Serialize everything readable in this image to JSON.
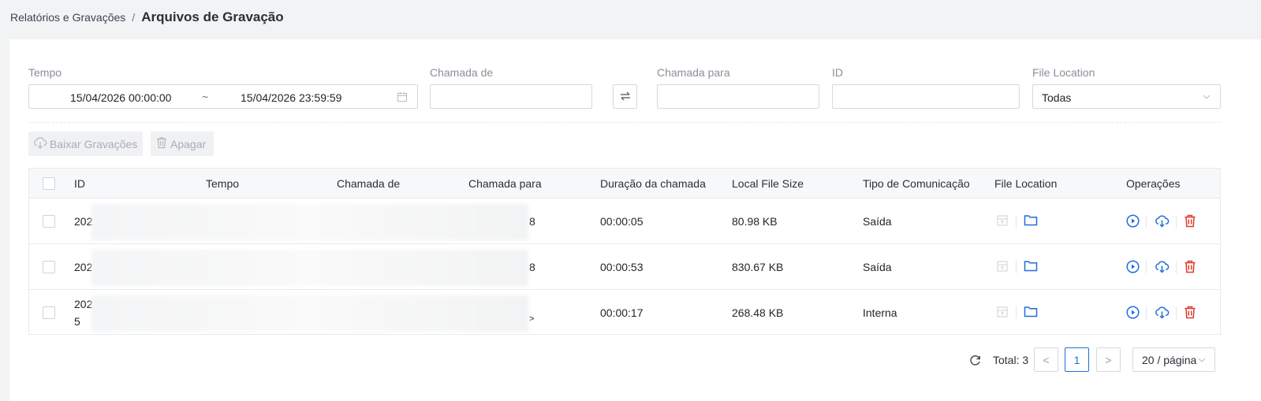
{
  "breadcrumb": {
    "parent": "Relatórios e Gravações",
    "separator": "/",
    "current": "Arquivos de Gravação"
  },
  "filters": {
    "tempo_label": "Tempo",
    "date_start": "15/04/2026 00:00:00",
    "date_separator": "~",
    "date_end": "15/04/2026 23:59:59",
    "chamada_de_label": "Chamada de",
    "chamada_de_value": "",
    "chamada_para_label": "Chamada para",
    "chamada_para_value": "",
    "id_label": "ID",
    "id_value": "",
    "file_location_label": "File Location",
    "file_location_value": "Todas"
  },
  "actions": {
    "download": "Baixar Gravações",
    "delete": "Apagar"
  },
  "table": {
    "headers": [
      "ID",
      "Tempo",
      "Chamada de",
      "Chamada para",
      "Duração da chamada",
      "Local File Size",
      "Tipo de Comunicação",
      "File Location",
      "Operações"
    ],
    "rows": [
      {
        "id": "202",
        "id_extra": "",
        "chamada_para_suffix": "8",
        "duracao": "00:00:05",
        "size": "80.98 KB",
        "tipo": "Saída"
      },
      {
        "id": "202",
        "id_extra": "",
        "chamada_para_suffix": "8",
        "duracao": "00:00:53",
        "size": "830.67 KB",
        "tipo": "Saída"
      },
      {
        "id": "202",
        "id_extra": "5",
        "chamada_para_suffix": ">",
        "duracao": "00:00:17",
        "size": "268.48 KB",
        "tipo": "Interna"
      }
    ]
  },
  "pagination": {
    "total_label": "Total: 3",
    "current_page": "1",
    "page_size": "20 / página",
    "prev": "<",
    "next": ">"
  },
  "colors": {
    "accent": "#1e6fd9",
    "danger": "#e0392b",
    "disabled": "#c9ccd1"
  }
}
